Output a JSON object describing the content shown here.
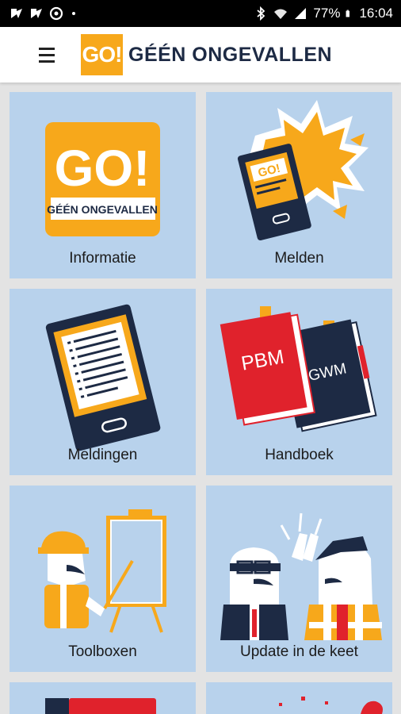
{
  "status_bar": {
    "battery": "77%",
    "time": "16:04",
    "icons": [
      "notification-icon",
      "notification-icon",
      "sync-icon",
      "bluetooth-icon",
      "wifi-icon",
      "signal-icon",
      "battery-icon"
    ]
  },
  "app_bar": {
    "menu_icon": "hamburger-menu-icon",
    "logo_box": "GO!",
    "logo_text": "GÉÉN ONGEVALLEN"
  },
  "tiles": [
    {
      "label": "Informatie",
      "logo_big": "GO!",
      "logo_sub": "GÉÉN ONGEVALLEN"
    },
    {
      "label": "Melden",
      "phone_text": "GO!"
    },
    {
      "label": "Meldingen"
    },
    {
      "label": "Handboek",
      "book1": "PBM",
      "book2": "VGWM"
    },
    {
      "label": "Toolboxen"
    },
    {
      "label": "Update in de keet"
    }
  ],
  "colors": {
    "brand_orange": "#f7a81b",
    "navy": "#1d2a44",
    "tile_bg": "#b8d2ec",
    "red": "#e0222c"
  }
}
